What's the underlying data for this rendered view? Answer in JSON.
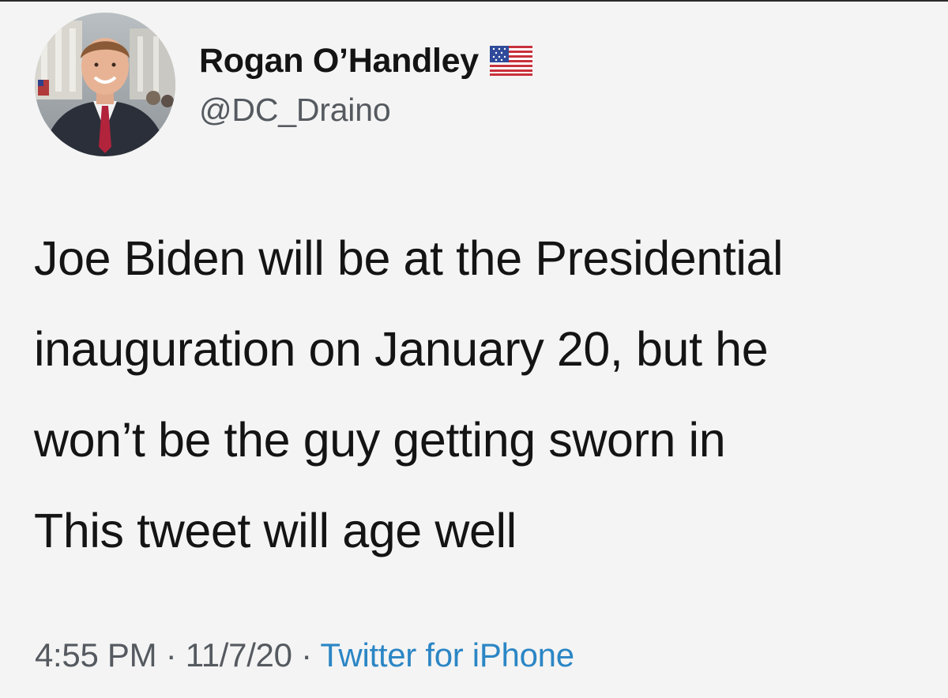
{
  "author": {
    "display_name": "Rogan O’Handley",
    "handle": "@DC_Draino",
    "badge_icon": "us-flag-icon",
    "avatar_icon": "profile-photo"
  },
  "tweet": {
    "lines": [
      "Joe Biden will be at the Presidential",
      "inauguration on January 20, but he",
      "won’t be the guy getting sworn in"
    ],
    "second_paragraph": "This tweet will age well"
  },
  "meta": {
    "time": "4:55 PM",
    "separator": "·",
    "date": "11/7/20",
    "source": "Twitter for iPhone"
  },
  "colors": {
    "background": "#f4f4f4",
    "text": "#141414",
    "secondary_text": "#555a60",
    "link": "#2b86c5"
  }
}
